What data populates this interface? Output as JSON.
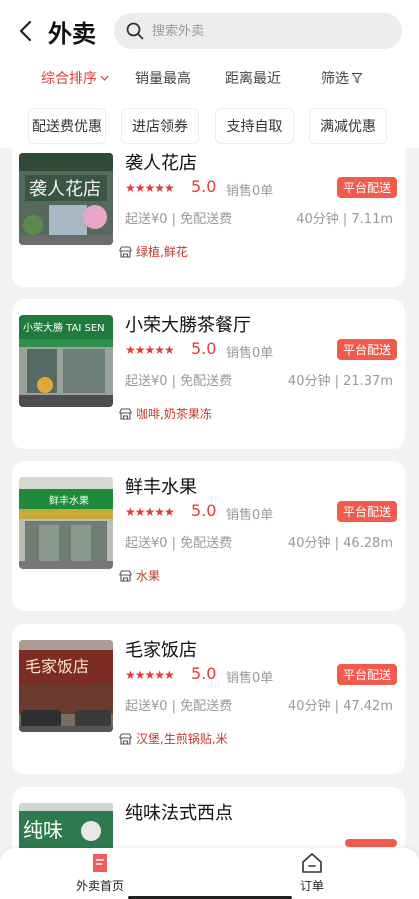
{
  "header": {
    "title": "外卖",
    "search_placeholder": "搜索外卖"
  },
  "sort": {
    "items": [
      {
        "label": "综合排序",
        "active": true
      },
      {
        "label": "销量最高",
        "active": false
      },
      {
        "label": "距离最近",
        "active": false
      },
      {
        "label": "筛选",
        "active": false
      }
    ]
  },
  "filters": [
    "配送费优惠",
    "进店领券",
    "支持自取",
    "满减优惠"
  ],
  "stores": [
    {
      "name": "袭人花店",
      "stars": "★★★★★",
      "rating": "5.0",
      "sales": "销售0单",
      "badge": "平台配送",
      "delivery": "起送¥0 | 免配送费",
      "distance": "40分钟 | 7.11m",
      "category": "绿植,鲜花",
      "sign_text": "袭人花店"
    },
    {
      "name": "小荣大勝茶餐厅",
      "stars": "★★★★★",
      "rating": "5.0",
      "sales": "销售0单",
      "badge": "平台配送",
      "delivery": "起送¥0 | 免配送费",
      "distance": "40分钟 | 21.37m",
      "category": "咖啡,奶茶果冻",
      "sign_text": "小荣大勝 TAI SEN"
    },
    {
      "name": "鲜丰水果",
      "stars": "★★★★★",
      "rating": "5.0",
      "sales": "销售0单",
      "badge": "平台配送",
      "delivery": "起送¥0 | 免配送费",
      "distance": "40分钟 | 46.28m",
      "category": "水果",
      "sign_text": "鲜丰水果"
    },
    {
      "name": "毛家饭店",
      "stars": "★★★★★",
      "rating": "5.0",
      "sales": "销售0单",
      "badge": "平台配送",
      "delivery": "起送¥0 | 免配送费",
      "distance": "40分钟 | 47.42m",
      "category": "汉堡,生煎锅贴,米",
      "sign_text": "毛家饭店"
    },
    {
      "name": "纯味法式西点",
      "sign_text": "纯味"
    }
  ],
  "bottom_nav": {
    "items": [
      {
        "label": "外卖首页",
        "active": true
      },
      {
        "label": "订单",
        "active": false
      }
    ]
  },
  "colors": {
    "accent": "#e63a3a",
    "badge": "#f15b4e",
    "category": "#c0392b"
  }
}
